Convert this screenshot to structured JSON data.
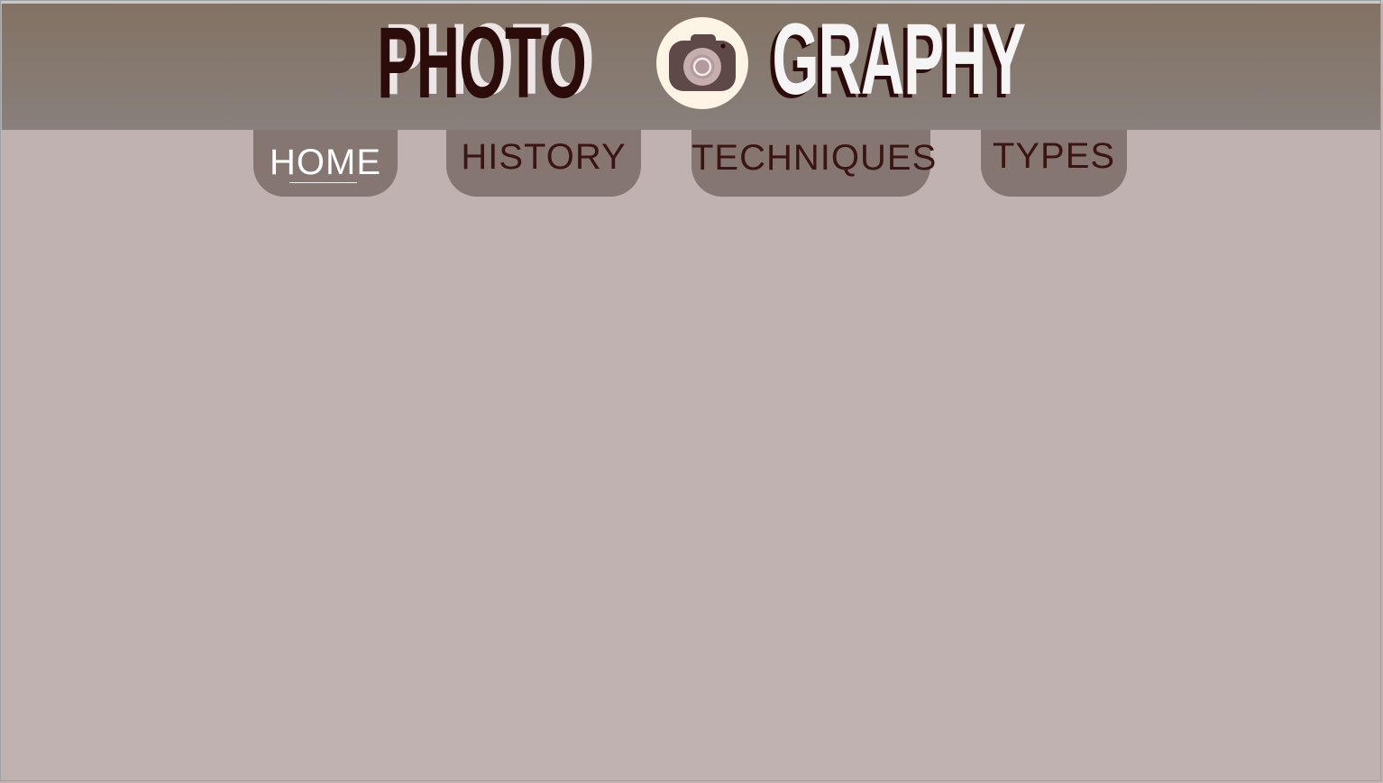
{
  "logo": {
    "word_left": "PHOTO",
    "word_right": "GRAPHY",
    "icon": "camera-icon"
  },
  "nav": {
    "items": [
      {
        "label": "HOME",
        "active": true
      },
      {
        "label": "HISTORY",
        "active": false
      },
      {
        "label": "TECHNIQUES",
        "active": false
      },
      {
        "label": "TYPES",
        "active": false
      }
    ]
  },
  "colors": {
    "header_top": "#837263",
    "header_bottom": "#88807c",
    "page_background": "#bfb2b1",
    "tab_background": "#857671",
    "tab_text": "#3b1414",
    "tab_active_text": "#ffffff",
    "logo_dark": "#2c0b0b",
    "logo_light": "#f6f5f5",
    "camera_badge": "#fdf4e5",
    "camera_body": "#5f4848"
  }
}
